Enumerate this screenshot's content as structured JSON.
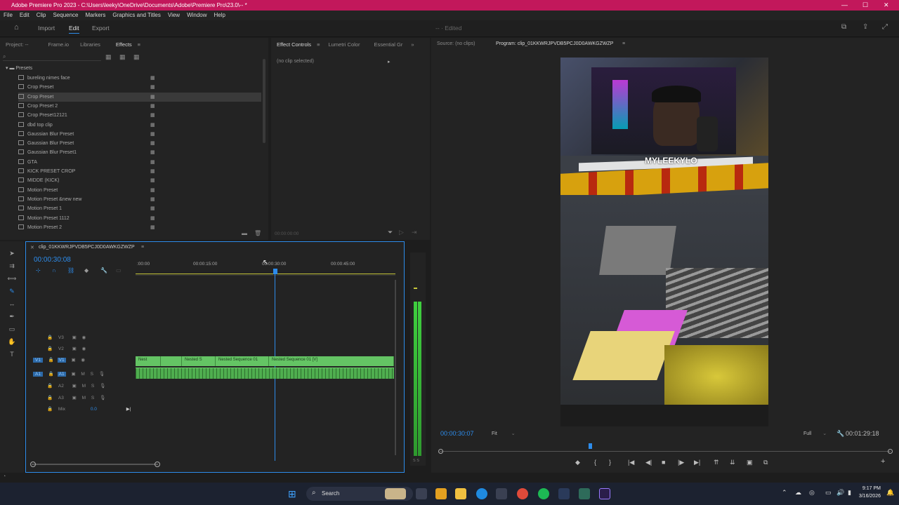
{
  "window": {
    "title": "Adobe Premiere Pro 2023 - C:\\Users\\leeky\\OneDrive\\Documents\\Adobe\\Premiere Pro\\23.0\\-- *",
    "controls": [
      "—",
      "☐",
      "✕"
    ]
  },
  "menu": [
    "File",
    "Edit",
    "Clip",
    "Sequence",
    "Markers",
    "Graphics and Titles",
    "View",
    "Window",
    "Help"
  ],
  "workspace": {
    "tabs": [
      "Import",
      "Edit",
      "Export"
    ],
    "active": "Edit",
    "status": "-- · Edited"
  },
  "project_panel": {
    "tabs": [
      "Project: --",
      "Frame.io",
      "Libraries",
      "Effects"
    ],
    "active_tab": "Effects",
    "folder": "Presets",
    "presets": [
      "bureling nimes face",
      "Crop Preset",
      "Crop Preset",
      "Crop Preset 2",
      "Crop Preset12121",
      "dbd top clip",
      "Gaussian Blur Preset",
      "Gaussian Blur Preset",
      "Gaussian Blur Preset1",
      "GTA",
      "KICK PRESET CROP",
      "MIDDE (KICK)",
      "Motion Preset",
      "Motion Preset &new new",
      "Motion Preset 1",
      "Motion Preset 1112",
      "Motion Preset 2"
    ],
    "selected_index": 2
  },
  "effect_controls": {
    "tabs": [
      "Effect Controls",
      "Lumetri Color",
      "Essential Gr"
    ],
    "active_tab": "Effect Controls",
    "message": "(no clip selected)",
    "timecode": "00:00:00:00"
  },
  "timeline": {
    "sequence_name": "clip_01KKWRJPVDB5PCJ0D0AWKGZWZP",
    "timecode": "00:00:30:08",
    "ruler_labels": [
      ":00:00",
      "00:00:15:00",
      "00:00:30:00",
      "00:00:45:00"
    ],
    "video_tracks": [
      "V3",
      "V2",
      "V1"
    ],
    "audio_tracks": [
      "A1",
      "A2",
      "A3"
    ],
    "mix_label": "Mix",
    "mix_value": "0.0",
    "clips": [
      "Nest",
      "Nested S",
      "Nested Sequence 01",
      "Nested Sequence 01 [V]"
    ],
    "meter_label": "S S"
  },
  "program_monitor": {
    "source_tab": "Source: (no clips)",
    "program_tab": "Program: clip_01KKWRJPVDB5PCJ0D0AWKGZWZP",
    "timecode": "00:00:30:07",
    "zoom": "Fit",
    "quality": "Full",
    "duration": "00:01:29:18",
    "overlay_username": "MYLEEKYLO"
  },
  "taskbar": {
    "search_label": "Search",
    "time": "9:17 PM",
    "date": "3/16/2026"
  },
  "colors": {
    "accent": "#2d8ceb",
    "titlebar": "#c2185b",
    "clip_green": "#64c464"
  }
}
